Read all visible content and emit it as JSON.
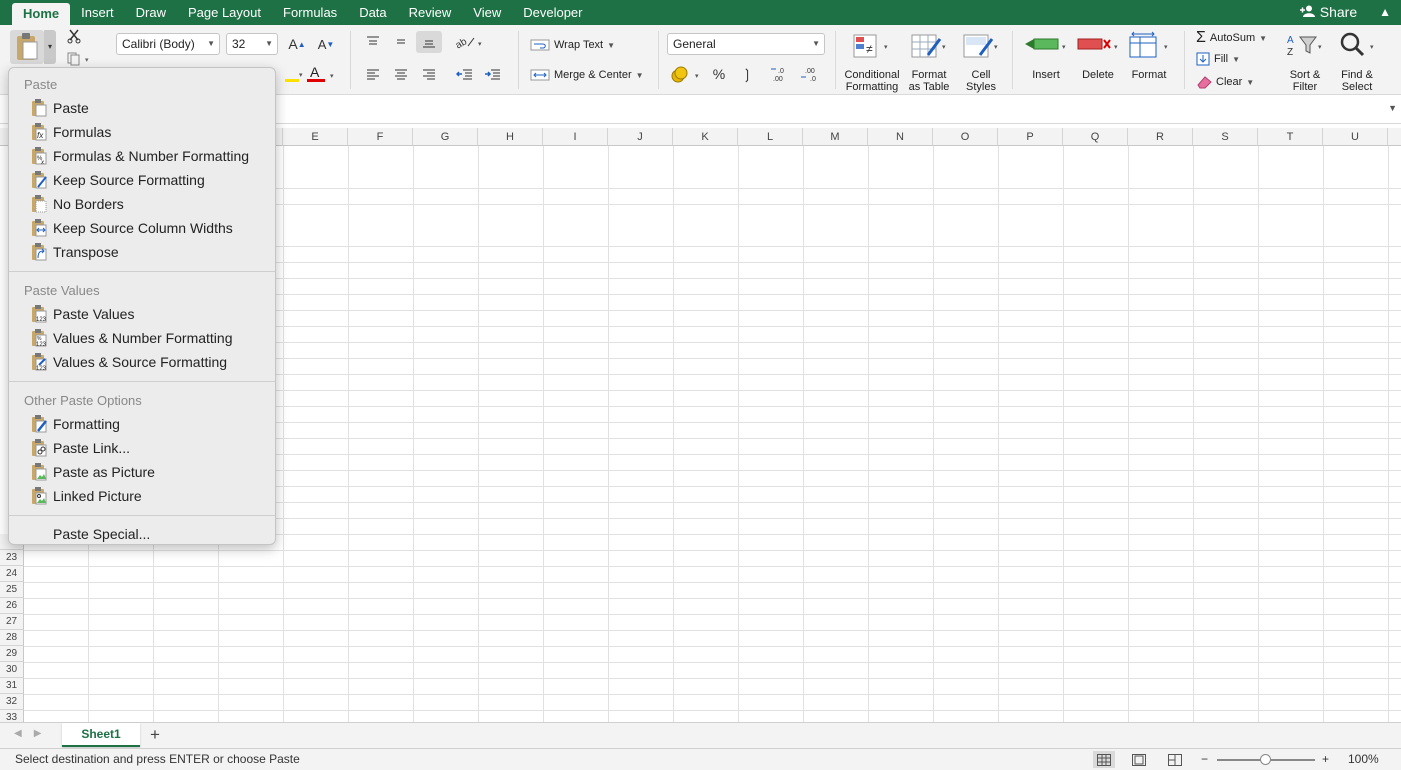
{
  "tabs": [
    "Home",
    "Insert",
    "Draw",
    "Page Layout",
    "Formulas",
    "Data",
    "Review",
    "View",
    "Developer"
  ],
  "share_label": "Share",
  "ribbon": {
    "font_name": "Calibri (Body)",
    "font_size": "32",
    "wrap_text": "Wrap Text",
    "merge_center": "Merge & Center",
    "number_format": "General",
    "percent": "%",
    "conditional_formatting": [
      "Conditional",
      "Formatting"
    ],
    "format_as_table": [
      "Format",
      "as Table"
    ],
    "cell_styles": [
      "Cell",
      "Styles"
    ],
    "insert": "Insert",
    "delete": "Delete",
    "format": "Format",
    "autosum": "AutoSum",
    "fill": "Fill",
    "clear": "Clear",
    "sort_filter": [
      "Sort &",
      "Filter"
    ],
    "find_select": [
      "Find &",
      "Select"
    ]
  },
  "columns": [
    "E",
    "F",
    "G",
    "H",
    "I",
    "J",
    "K",
    "L",
    "M",
    "N",
    "O",
    "P",
    "Q",
    "R",
    "S",
    "T",
    "U"
  ],
  "rows_visible": [
    "23",
    "24",
    "25",
    "26",
    "27",
    "28",
    "29",
    "30",
    "31",
    "32",
    "33"
  ],
  "paste_menu": {
    "sections": [
      {
        "header": "Paste",
        "items": [
          "Paste",
          "Formulas",
          "Formulas & Number Formatting",
          "Keep Source Formatting",
          "No Borders",
          "Keep Source Column Widths",
          "Transpose"
        ]
      },
      {
        "header": "Paste Values",
        "items": [
          "Paste Values",
          "Values & Number Formatting",
          "Values & Source Formatting"
        ]
      },
      {
        "header": "Other Paste Options",
        "items": [
          "Formatting",
          "Paste Link...",
          "Paste as Picture",
          "Linked Picture"
        ]
      }
    ],
    "paste_special": "Paste Special..."
  },
  "sheet": {
    "name": "Sheet1",
    "add_symbol": "+"
  },
  "status": {
    "message": "Select destination and press ENTER or choose Paste",
    "zoom": "100%",
    "zoom_minus": "−",
    "zoom_plus": "+"
  },
  "colors": {
    "accent": "#1e7145",
    "font_color_bar": "#e00000"
  }
}
